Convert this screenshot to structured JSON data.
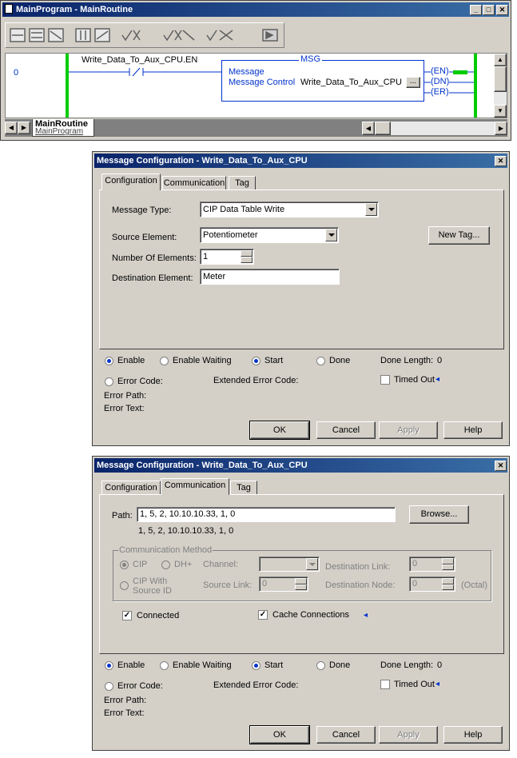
{
  "ladder_window": {
    "title": "MainProgram - MainRoutine",
    "rung_number": "0",
    "contact_tag": "Write_Data_To_Aux_CPU.EN",
    "instruction": "MSG",
    "message_label": "Message",
    "message_control_label": "Message Control",
    "message_control_value": "Write_Data_To_Aux_CPU",
    "ellipsis_label": "...",
    "outputs": [
      "EN",
      "DN",
      "ER"
    ],
    "routine_tab_title": "MainRoutine",
    "routine_tab_subtitle": "MainProgram"
  },
  "dialog1": {
    "title": "Message Configuration - Write_Data_To_Aux_CPU",
    "tabs": [
      "Configuration",
      "Communication",
      "Tag"
    ],
    "active_tab": "Configuration",
    "message_type_label": "Message Type:",
    "message_type_value": "CIP Data Table Write",
    "source_element_label": "Source Element:",
    "source_element_value": "Potentiometer",
    "num_elements_label": "Number Of Elements:",
    "num_elements_value": "1",
    "destination_element_label": "Destination Element:",
    "destination_element_value": "Meter",
    "new_tag_label": "New Tag..."
  },
  "dialog2": {
    "title": "Message Configuration - Write_Data_To_Aux_CPU",
    "tabs": [
      "Configuration",
      "Communication",
      "Tag"
    ],
    "active_tab": "Communication",
    "path_label": "Path:",
    "path_value": "1, 5, 2, 10.10.10.33, 1, 0",
    "path_display": "1, 5, 2, 10.10.10.33, 1, 0",
    "browse_label": "Browse...",
    "comm_method_label": "Communication Method",
    "cip_label": "CIP",
    "dhplus_label": "DH+",
    "channel_label": "Channel:",
    "destination_link_label": "Destination Link:",
    "destination_link_value": "0",
    "cip_with_source_id_label_1": "CIP With",
    "cip_with_source_id_label_2": "Source ID",
    "source_link_label": "Source Link:",
    "source_link_value": "0",
    "destination_node_label": "Destination Node:",
    "destination_node_value": "0",
    "octal_label": "(Octal)",
    "connected_label": "Connected",
    "cache_connections_label": "Cache Connections"
  },
  "status": {
    "enable_label": "Enable",
    "enable_waiting_label": "Enable Waiting",
    "start_label": "Start",
    "done_label": "Done",
    "done_length_label": "Done Length:",
    "done_length_value": "0",
    "error_code_label": "Error Code:",
    "extended_error_code_label": "Extended Error Code:",
    "timed_out_label": "Timed Out",
    "error_path_label": "Error Path:",
    "error_text_label": "Error Text:"
  },
  "buttons": {
    "ok": "OK",
    "cancel": "Cancel",
    "apply": "Apply",
    "help": "Help"
  },
  "colors": {
    "title_bar": "#0a246a",
    "dialog_bg": "#d4d0c8",
    "ladder_rail": "#00cc00",
    "ladder_wire": "#0033cc",
    "radio_dot": "#0033cc"
  }
}
